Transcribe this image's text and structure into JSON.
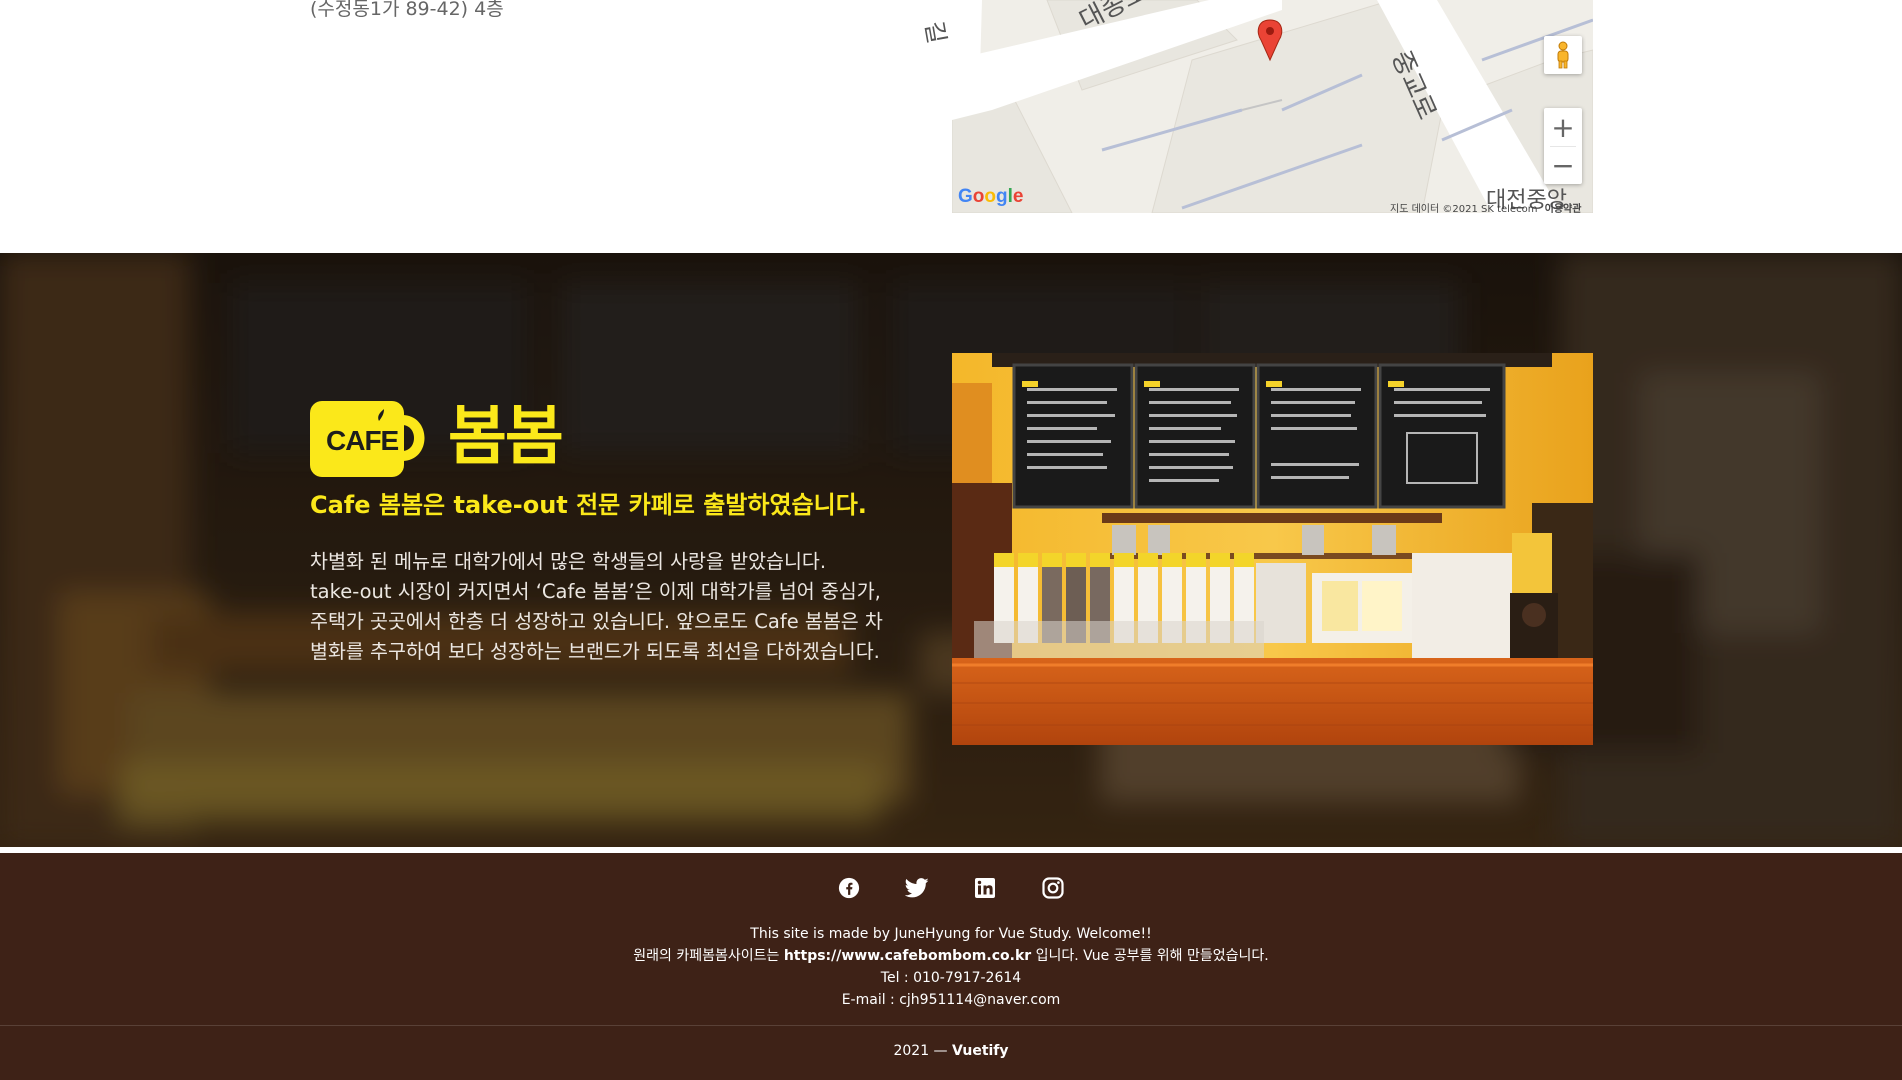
{
  "location": {
    "address_line": "(수정동1가 89-42) 4층",
    "map": {
      "streets": [
        "대종로",
        "중교로",
        "길",
        "대전중앙"
      ],
      "provider_logo": "Google",
      "attribution": "지도 데이터 ©2021 SK telecom",
      "terms_label": "이용약관",
      "zoom_in_label": "+",
      "zoom_out_label": "−",
      "pegman_icon": "pegman-icon",
      "marker_icon": "map-pin-icon",
      "marker_color": "#ea4335"
    }
  },
  "about": {
    "logo": {
      "cup_label": "CAFE",
      "name": "봄봄",
      "brand_color": "#fbe81a"
    },
    "headline": "Cafe 봄봄은 take-out 전문 카페로 출발하였습니다.",
    "body_lines": [
      "차별화 된 메뉴로 대학가에서 많은 학생들의 사랑을 받았습니다.",
      "take-out 시장이 커지면서 ‘Cafe 봄봄’은 이제 대학가를 넘어 중심가,",
      "주택가 곳곳에서 한층 더 성장하고 있습니다. 앞으로도 Cafe 봄봄은 차",
      "별화를 추구하여 보다 성장하는 브랜드가 되도록 최선을 다하겠습니다."
    ],
    "photo_icon": "cafe-counter-photo"
  },
  "footer": {
    "social": [
      {
        "name": "facebook-icon"
      },
      {
        "name": "twitter-icon"
      },
      {
        "name": "linkedin-icon"
      },
      {
        "name": "instagram-icon"
      }
    ],
    "made_by": "This site is made by JuneHyung for Vue Study. Welcome!!",
    "original_prefix": "원래의 카페봄봄사이트는 ",
    "original_url": "https://www.cafebombom.co.kr",
    "original_suffix": " 입니다. Vue 공부를 위해 만들었습니다.",
    "tel": "Tel : 010-7917-2614",
    "email": "E-mail : cjh951114@naver.com",
    "year": "2021 —",
    "framework": "Vuetify",
    "background_color": "#3e2217"
  }
}
